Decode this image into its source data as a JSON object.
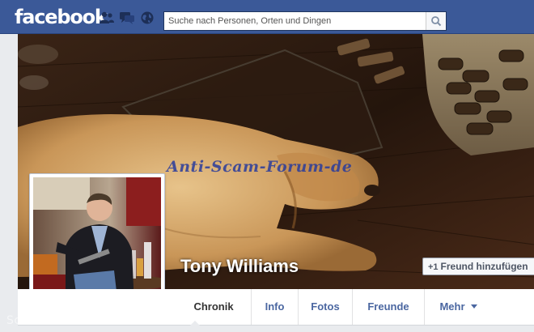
{
  "header": {
    "logo_text": "facebook",
    "brand_color": "#3b5998",
    "icons": [
      "friend-requests-icon",
      "messages-icon",
      "notifications-globe-icon"
    ],
    "search": {
      "placeholder": "Suche nach Personen, Orten und Dingen",
      "value": "",
      "icon": "magnifier-icon"
    }
  },
  "cover": {
    "watermark": "Anti-Scam-Forum-de"
  },
  "profile": {
    "name": "Tony Williams",
    "add_friend_label": "Freund hinzufügen",
    "add_friend_icon": "+1"
  },
  "tabs": [
    {
      "label": "Chronik",
      "active": true
    },
    {
      "label": "Info"
    },
    {
      "label": "Fotos"
    },
    {
      "label": "Freunde"
    },
    {
      "label": "Mehr"
    }
  ],
  "footer_watermark": "ScamTV.info"
}
